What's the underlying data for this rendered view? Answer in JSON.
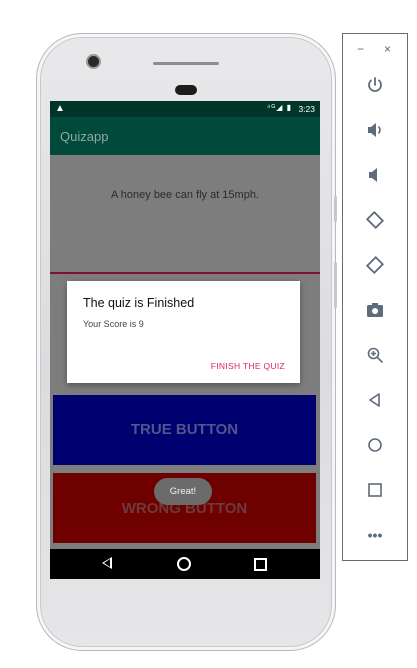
{
  "status_bar": {
    "time": "3:23",
    "signal_icons": "⁴ᴳ◢ ▮"
  },
  "app_bar": {
    "title": "Quizapp"
  },
  "question": {
    "text": "A honey bee can fly at 15mph."
  },
  "buttons": {
    "true_label": "TRUE BUTTON",
    "wrong_label": "WRONG BUTTON"
  },
  "dialog": {
    "title": "The quiz is Finished",
    "message": "Your Score is 9",
    "action": "FINISH THE QUIZ"
  },
  "toast": {
    "text": "Great!"
  },
  "emulator_panel": {
    "minimize": "−",
    "close": "×",
    "tools": [
      "power-icon",
      "volume-up-icon",
      "volume-down-icon",
      "rotate-left-icon",
      "rotate-right-icon",
      "camera-icon",
      "zoom-icon",
      "back-icon",
      "home-icon",
      "overview-icon",
      "more-icon"
    ],
    "more_label": "•••"
  },
  "colors": {
    "appbar": "#00493b",
    "true_button": "#000071",
    "wrong_button": "#6e0000",
    "dialog_action": "#e0245e"
  }
}
